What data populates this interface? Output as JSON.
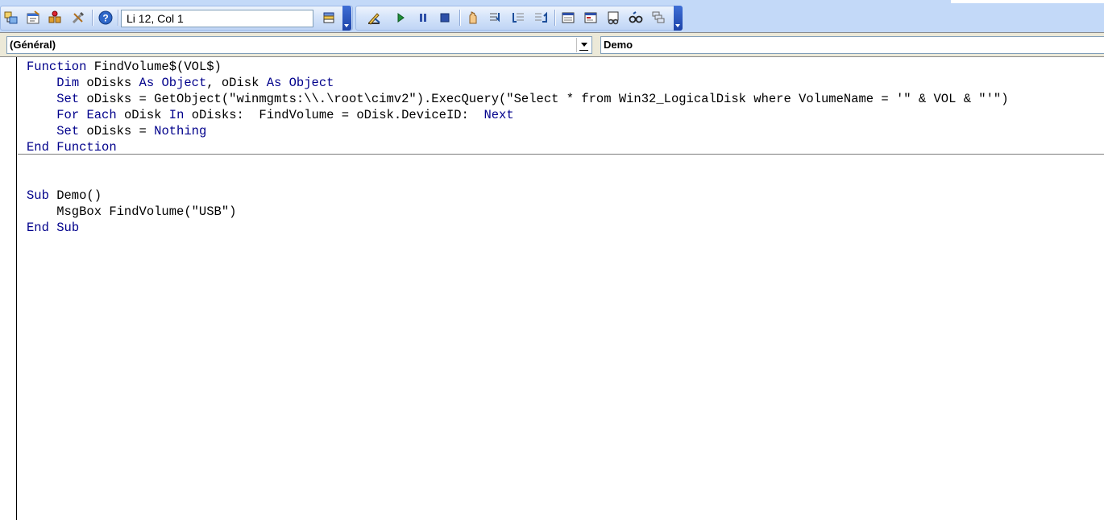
{
  "toolbar": {
    "status_text": "Li 12, Col 1",
    "buttons": [
      "project-explorer-icon",
      "properties-icon",
      "object-browser-icon",
      "toolbox-icon",
      "help-icon",
      "insert-module-icon",
      "design-mode-icon",
      "run-icon",
      "break-icon",
      "reset-icon",
      "toggle-breakpoint-icon",
      "step-into-icon",
      "step-over-icon",
      "step-out-icon",
      "locals-window-icon",
      "immediate-window-icon",
      "watch-window-icon",
      "quick-watch-icon",
      "call-stack-icon"
    ]
  },
  "selectors": {
    "object": "(Général)",
    "procedure": "Demo"
  },
  "colors": {
    "keyword": "#00008b",
    "toolbar_bg": "#c3d9f8",
    "grip": "#2a55c2"
  },
  "code": {
    "lines": [
      [
        {
          "t": "Function",
          "k": true
        },
        {
          "t": " FindVolume$(VOL$)"
        }
      ],
      [
        {
          "t": "    "
        },
        {
          "t": "Dim",
          "k": true
        },
        {
          "t": " oDisks "
        },
        {
          "t": "As",
          "k": true
        },
        {
          "t": " "
        },
        {
          "t": "Object",
          "k": true
        },
        {
          "t": ", oDisk "
        },
        {
          "t": "As",
          "k": true
        },
        {
          "t": " "
        },
        {
          "t": "Object",
          "k": true
        }
      ],
      [
        {
          "t": "    "
        },
        {
          "t": "Set",
          "k": true
        },
        {
          "t": " oDisks = GetObject(\"winmgmts:\\\\.\\root\\cimv2\").ExecQuery(\"Select * from Win32_LogicalDisk where VolumeName = '\" & VOL & \"'\")"
        }
      ],
      [
        {
          "t": "    "
        },
        {
          "t": "For",
          "k": true
        },
        {
          "t": " "
        },
        {
          "t": "Each",
          "k": true
        },
        {
          "t": " oDisk "
        },
        {
          "t": "In",
          "k": true
        },
        {
          "t": " oDisks:  FindVolume = oDisk.DeviceID:  "
        },
        {
          "t": "Next",
          "k": true
        }
      ],
      [
        {
          "t": "    "
        },
        {
          "t": "Set",
          "k": true
        },
        {
          "t": " oDisks = "
        },
        {
          "t": "Nothing",
          "k": true
        }
      ],
      [
        {
          "t": "End",
          "k": true
        },
        {
          "t": " "
        },
        {
          "t": "Function",
          "k": true
        }
      ],
      [],
      [],
      [
        {
          "t": "Sub",
          "k": true
        },
        {
          "t": " Demo()"
        }
      ],
      [
        {
          "t": "    MsgBox FindVolume(\"USB\")"
        }
      ],
      [
        {
          "t": "End",
          "k": true
        },
        {
          "t": " "
        },
        {
          "t": "Sub",
          "k": true
        }
      ]
    ]
  }
}
